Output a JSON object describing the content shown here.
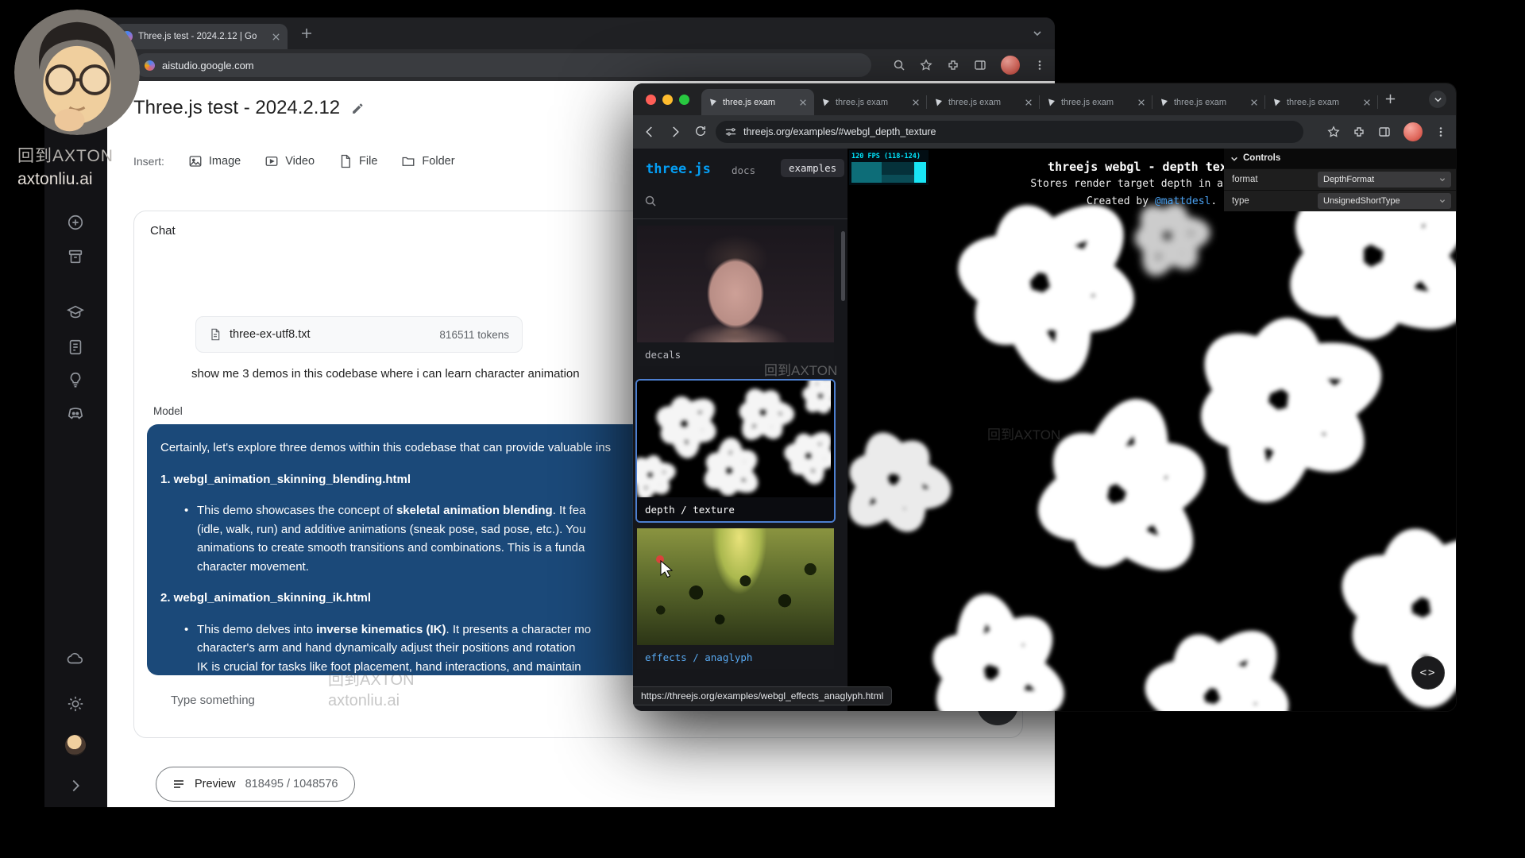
{
  "colors": {
    "model_block_bg": "#1b4979",
    "threejs_blue": "#049ef4",
    "selected_card_border": "#4d7fd0",
    "link_blue": "#4aa1f1",
    "stats_cyan": "#00e7ff"
  },
  "overlay": {
    "brand_line1": "回到AXTON",
    "brand_line2": "axtonliu.ai",
    "watermark1": "回到AXTON",
    "watermark2_line1": "回到AXTON",
    "watermark2_line2": "axtonliu.ai",
    "watermark3": "回到AXTON"
  },
  "studio_window": {
    "tab_title": "Three.js test - 2024.2.12 | Go",
    "url": "aistudio.google.com",
    "page": {
      "title": "Three.js test - 2024.2.12",
      "insert_label": "Insert:",
      "insert_actions": [
        {
          "label": "Image"
        },
        {
          "label": "Video"
        },
        {
          "label": "File"
        },
        {
          "label": "Folder"
        }
      ],
      "chat": {
        "heading": "Chat",
        "attachment": {
          "filename": "three-ex-utf8.txt",
          "tokens": "816511 tokens"
        },
        "user_prompt": "show me 3 demos in this codebase where i can learn character animation",
        "model_label": "Model",
        "model_response": {
          "lines": [
            {
              "type": "p",
              "text": "Certainly, let's explore three demos within this codebase that can provide valuable ins"
            },
            {
              "type": "h",
              "text": "1. webgl_animation_skinning_blending.html"
            },
            {
              "type": "bullet",
              "parts": [
                {
                  "t": "This demo showcases the concept of "
                },
                {
                  "t": "skeletal animation blending",
                  "b": true
                },
                {
                  "t": ". It fea"
                }
              ]
            },
            {
              "type": "cont",
              "text": "(idle, walk, run) and additive animations (sneak pose, sad pose, etc.). You"
            },
            {
              "type": "cont",
              "text": "animations to create smooth transitions and combinations. This is a funda"
            },
            {
              "type": "cont",
              "text": "character movement."
            },
            {
              "type": "h",
              "text": "2. webgl_animation_skinning_ik.html"
            },
            {
              "type": "bullet",
              "parts": [
                {
                  "t": "This demo delves into "
                },
                {
                  "t": "inverse kinematics (IK)",
                  "b": true
                },
                {
                  "t": ". It presents a character mo"
                }
              ]
            },
            {
              "type": "cont",
              "text": "character's arm and hand dynamically adjust their positions and rotation"
            },
            {
              "type": "cont",
              "text": "IK is crucial for tasks like foot placement, hand interactions, and maintain"
            }
          ]
        },
        "input_placeholder": "Type something"
      },
      "footer": {
        "preview_label": "Preview",
        "token_count": "818495 / 1048576"
      }
    }
  },
  "three_window": {
    "tabs": [
      {
        "label": "three.js exam",
        "active": true
      },
      {
        "label": "three.js exam"
      },
      {
        "label": "three.js exam"
      },
      {
        "label": "three.js exam"
      },
      {
        "label": "three.js exam"
      },
      {
        "label": "three.js exam"
      }
    ],
    "url": "threejs.org/examples/#webgl_depth_texture",
    "sidebar": {
      "logo": "three.js",
      "docs_label": "docs",
      "examples_label": "examples",
      "examples": [
        {
          "caption": "decals"
        },
        {
          "caption": "depth / texture"
        },
        {
          "caption": "effects / anaglyph"
        }
      ]
    },
    "status_url": "https://threejs.org/examples/webgl_effects_anaglyph.html",
    "viewer": {
      "stats_text": "120 FPS (118-124)",
      "info_line1": "threejs webgl - depth texture",
      "info_line2": "Stores render target depth in a texture",
      "info_line3_prefix": "Created by ",
      "info_line3_link": "@mattdesl",
      "info_line3_suffix": ".",
      "gui": {
        "title": "Controls",
        "rows": [
          {
            "label": "format",
            "value": "DepthFormat"
          },
          {
            "label": "type",
            "value": "UnsignedShortType"
          }
        ]
      }
    }
  }
}
